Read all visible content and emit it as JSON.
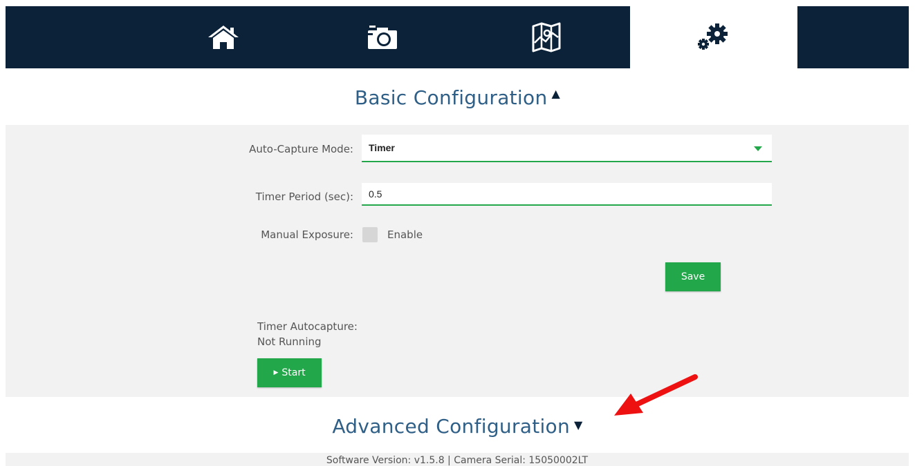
{
  "nav": {
    "tabs": [
      {
        "icon": "home-icon",
        "active": false
      },
      {
        "icon": "camera-icon",
        "active": false
      },
      {
        "icon": "map-icon",
        "active": false
      },
      {
        "icon": "gears-icon",
        "active": true
      }
    ]
  },
  "basic": {
    "title": "Basic Configuration",
    "auto_capture_label": "Auto-Capture Mode:",
    "auto_capture_value": "Timer",
    "timer_period_label": "Timer Period (sec):",
    "timer_period_value": "0.5",
    "manual_exposure_label": "Manual Exposure:",
    "enable_label": "Enable",
    "save_label": "Save",
    "timer_autocapture_label": "Timer Autocapture:",
    "timer_status": "Not Running",
    "start_label": "Start"
  },
  "advanced": {
    "title": "Advanced Configuration"
  },
  "footer": {
    "text": "Software Version: v1.5.8 | Camera Serial: 15050002LT"
  },
  "colors": {
    "nav_bg": "#0b2239",
    "accent_green": "#22a84a",
    "title_blue": "#2f5f86",
    "panel_bg": "#f2f2f2",
    "annotation_red": "#ee1111"
  }
}
